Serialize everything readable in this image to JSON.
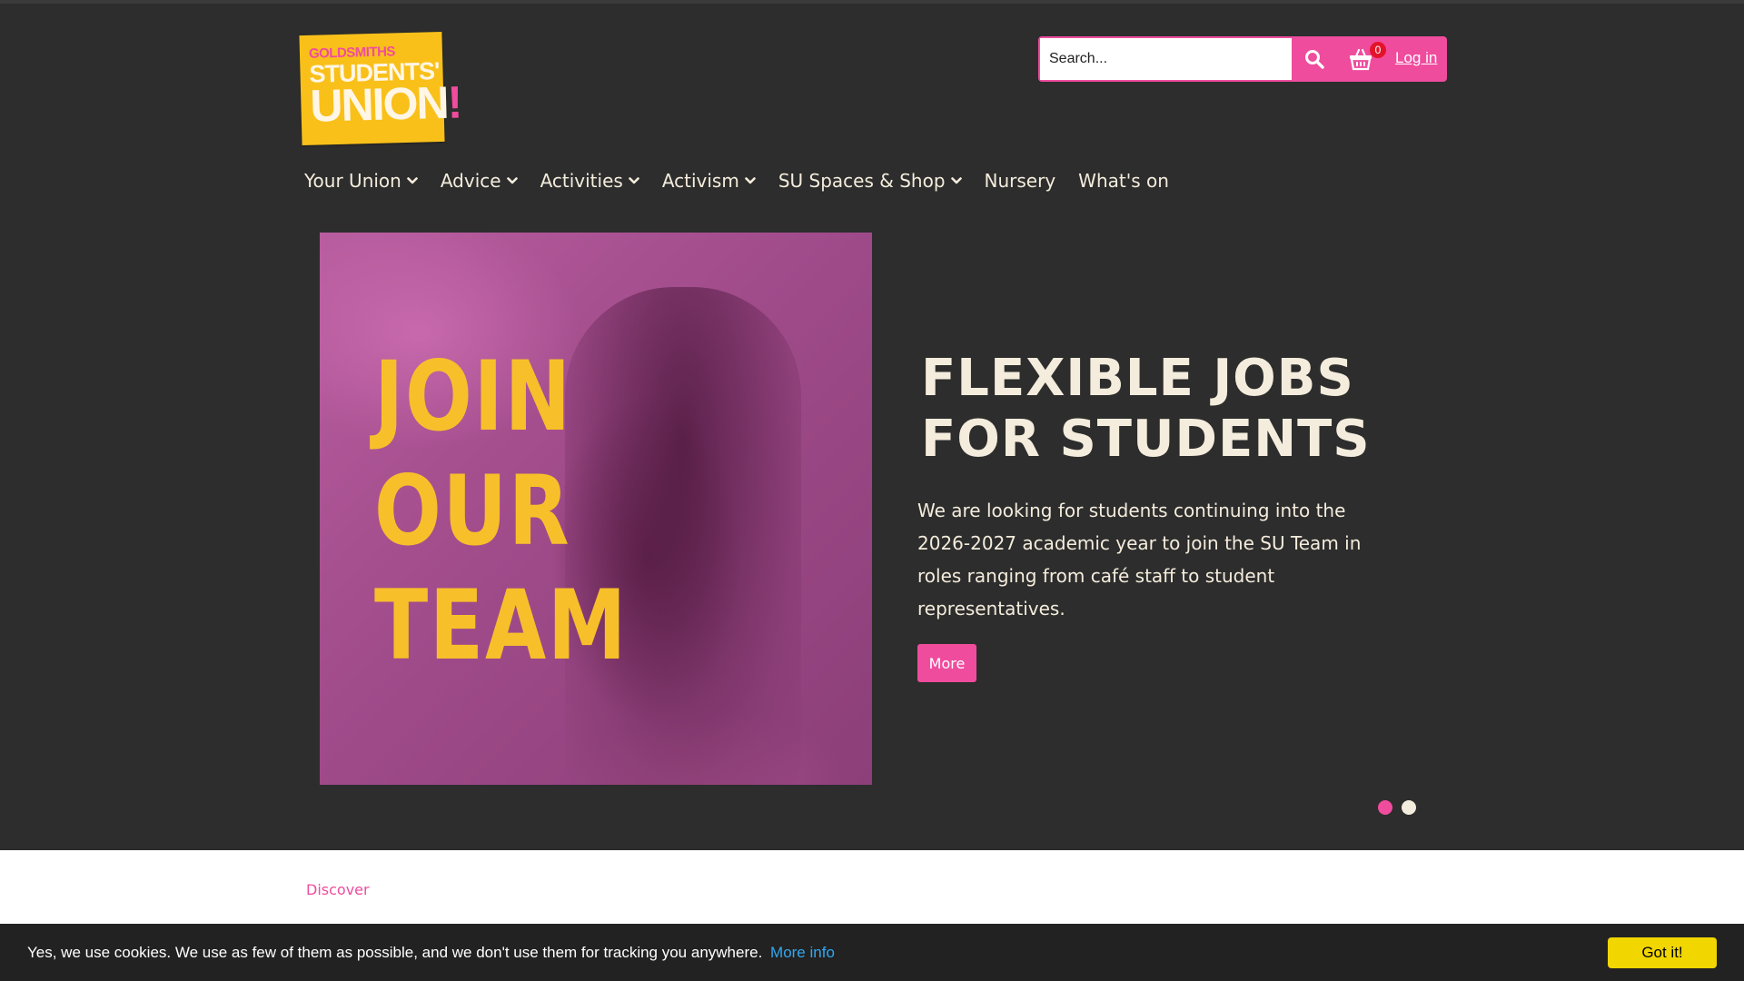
{
  "logo": {
    "line1": "GOLDSMITHS",
    "line2": "STUDENTS'",
    "line3": "UNION",
    "mark": "!"
  },
  "search": {
    "placeholder": "Search..."
  },
  "utility": {
    "search_icon": "search-icon",
    "cart_icon": "basket-icon",
    "cart_count": "0",
    "login_label": "Log in"
  },
  "nav": {
    "items": [
      {
        "label": "Your Union",
        "has_dropdown": true
      },
      {
        "label": "Advice",
        "has_dropdown": true
      },
      {
        "label": "Activities",
        "has_dropdown": true
      },
      {
        "label": "Activism",
        "has_dropdown": true
      },
      {
        "label": "SU Spaces & Shop",
        "has_dropdown": true
      },
      {
        "label": "Nursery",
        "has_dropdown": false
      },
      {
        "label": "What's on",
        "has_dropdown": false
      }
    ]
  },
  "hero": {
    "image_text": [
      "JOIN",
      "OUR",
      "TEAM"
    ],
    "title_line1": "FLEXIBLE JOBS",
    "title_line2": "FOR STUDENTS",
    "body": "We are looking for students continuing into the 2026-2027 academic year to join the SU Team in roles ranging from café staff to student representatives.",
    "button_label": "More",
    "slides_total": 2,
    "active_slide": 1
  },
  "section": {
    "discover_label": "Discover"
  },
  "cookie": {
    "text": "Yes, we use cookies. We use as few of them as possible, and we don't use them for tracking you anywhere.",
    "link_label": "More info",
    "button_label": "Got it!"
  },
  "colors": {
    "background": "#2d2d2d",
    "accent_pink": "#ef4c9e",
    "brand_yellow": "#f9c01a",
    "cream": "#f4ecdc",
    "cookie_button": "#f1d600",
    "cookie_link": "#31a8f0"
  }
}
